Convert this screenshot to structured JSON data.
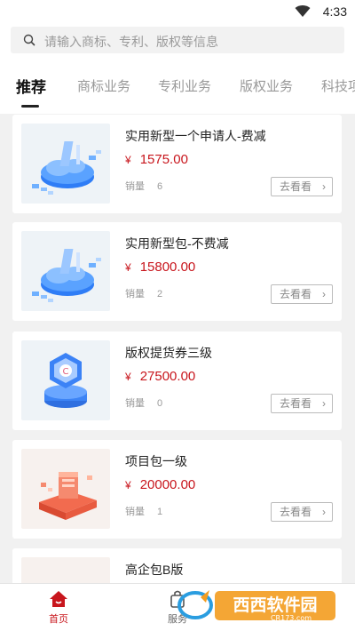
{
  "status": {
    "time": "4:33"
  },
  "search": {
    "placeholder": "请输入商标、专利、版权等信息"
  },
  "tabs": [
    {
      "label": "推荐",
      "active": true
    },
    {
      "label": "商标业务"
    },
    {
      "label": "专利业务"
    },
    {
      "label": "版权业务"
    },
    {
      "label": "科技项"
    }
  ],
  "products": [
    {
      "title": "实用新型一个申请人-费减",
      "currency": "¥",
      "price": "1575.00",
      "sales_label": "销量",
      "sales": "6",
      "button": "去看看",
      "icon": "patent-cloud-illustration"
    },
    {
      "title": "实用新型包-不费减",
      "currency": "¥",
      "price": "15800.00",
      "sales_label": "销量",
      "sales": "2",
      "button": "去看看",
      "icon": "patent-cloud-illustration"
    },
    {
      "title": "版权提货券三级",
      "currency": "¥",
      "price": "27500.00",
      "sales_label": "销量",
      "sales": "0",
      "button": "去看看",
      "icon": "copyright-hexagon-illustration"
    },
    {
      "title": "项目包一级",
      "currency": "¥",
      "price": "20000.00",
      "sales_label": "销量",
      "sales": "1",
      "button": "去看看",
      "icon": "project-package-illustration"
    },
    {
      "title": "高企包B版"
    }
  ],
  "bottom_nav": [
    {
      "label": "首页",
      "active": true,
      "icon": "home-icon"
    },
    {
      "label": "服务",
      "icon": "bag-icon"
    }
  ],
  "watermark": {
    "brand": "西西软件园",
    "url": "CR173.com"
  },
  "colors": {
    "price": "#c8161d",
    "accent": "#c8161d",
    "list_bg": "#f1f1f1"
  }
}
